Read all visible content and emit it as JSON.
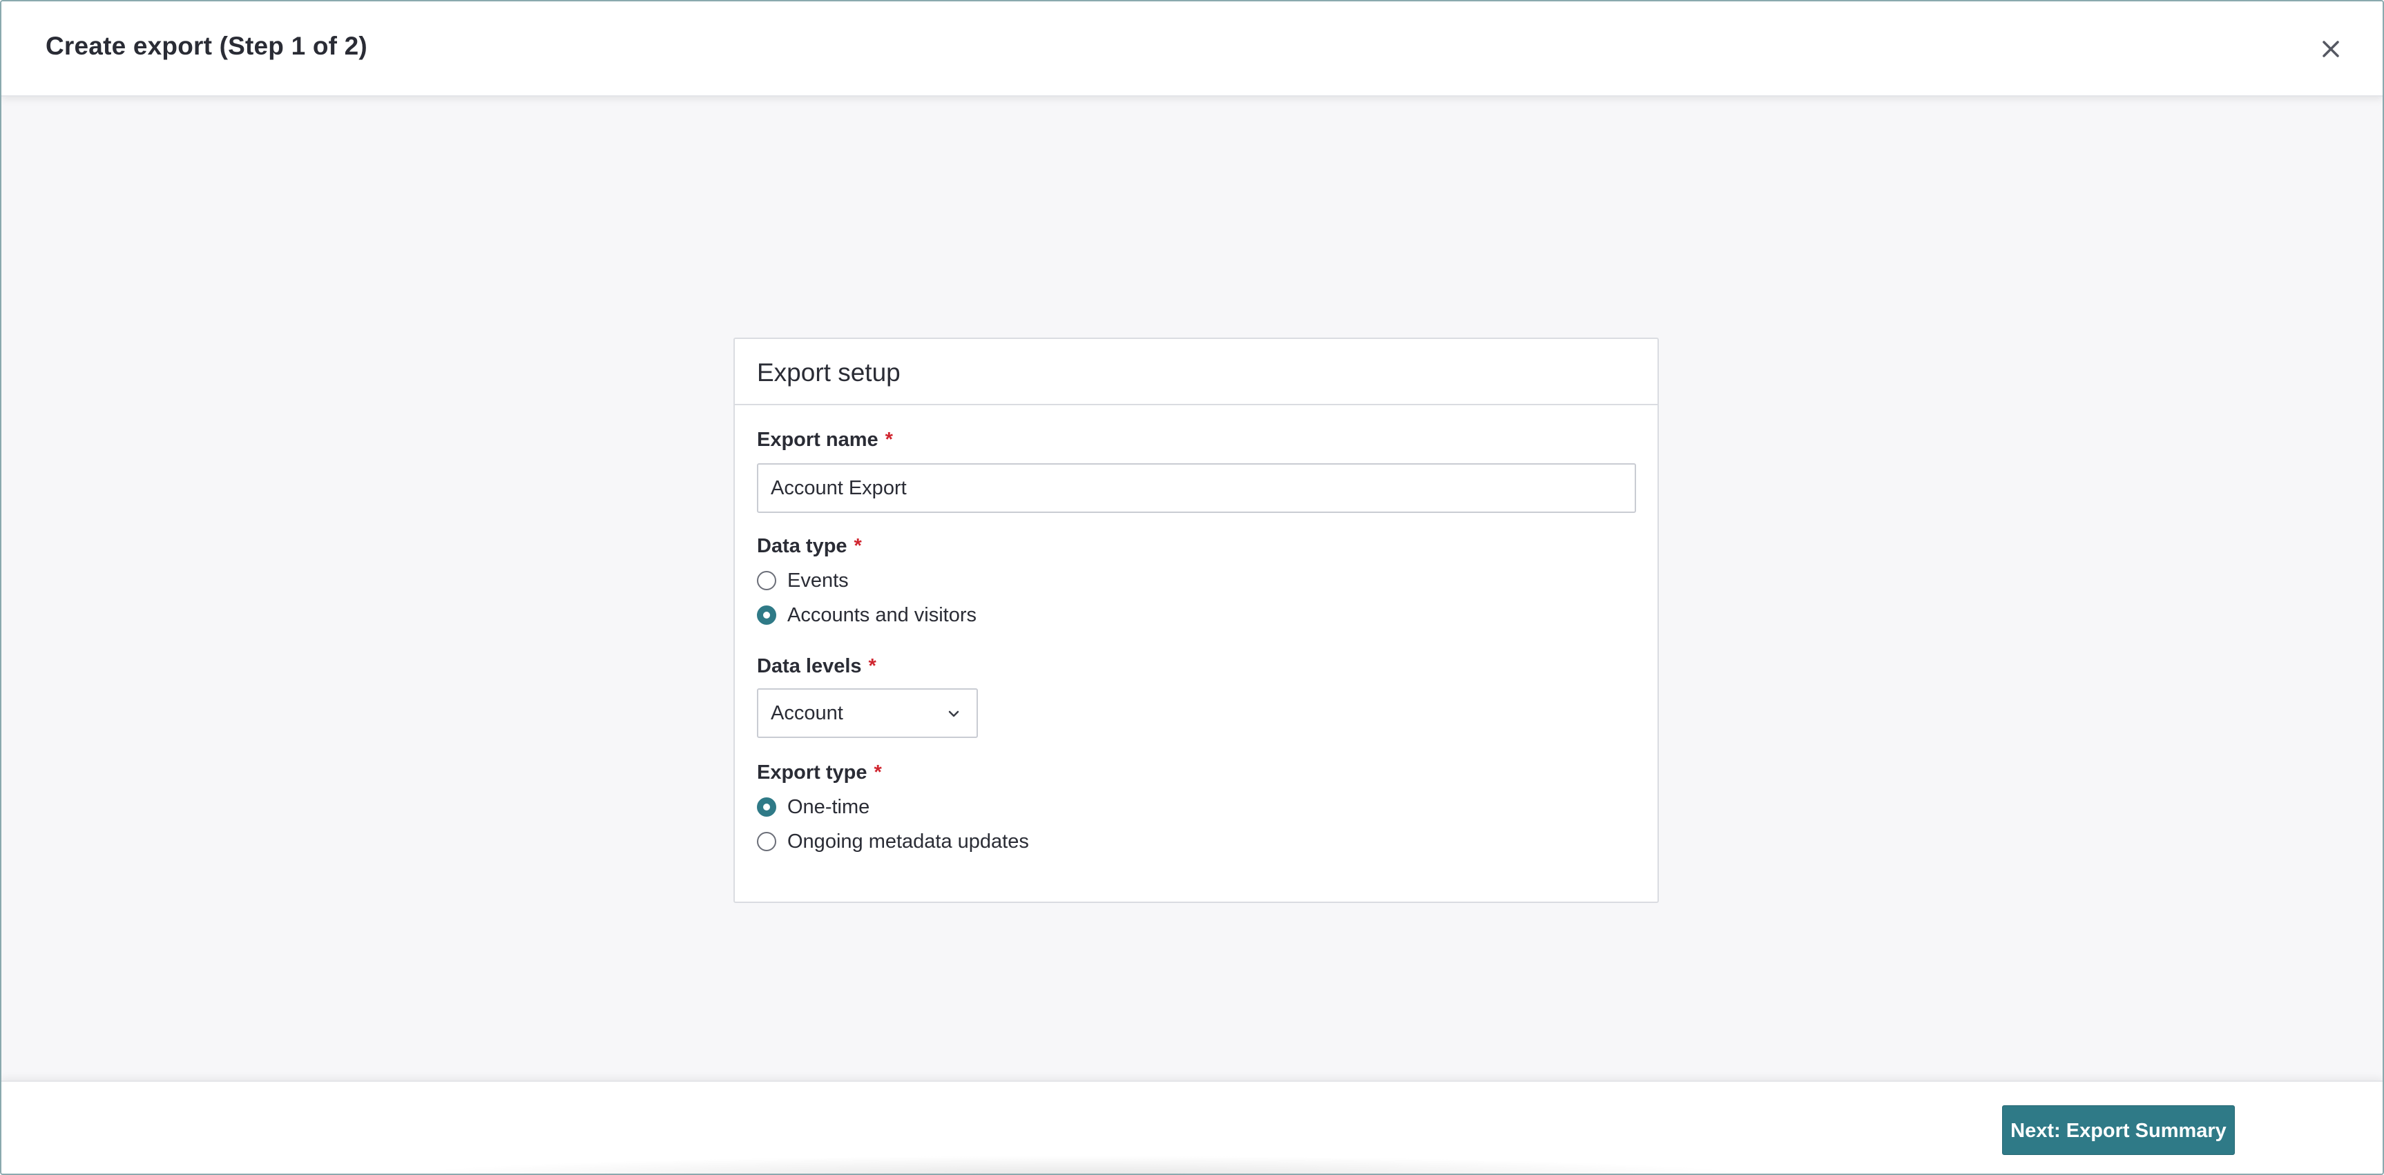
{
  "dialog": {
    "title": "Create export (Step 1 of 2)",
    "close_icon": "close-icon"
  },
  "card": {
    "title": "Export setup"
  },
  "form": {
    "export_name": {
      "label": "Export name",
      "required_marker": "*",
      "value": "Account Export"
    },
    "data_type": {
      "label": "Data type",
      "required_marker": "*",
      "options": [
        {
          "label": "Events",
          "selected": false
        },
        {
          "label": "Accounts and visitors",
          "selected": true
        }
      ]
    },
    "data_levels": {
      "label": "Data levels",
      "required_marker": "*",
      "selected": "Account"
    },
    "export_type": {
      "label": "Export type",
      "required_marker": "*",
      "options": [
        {
          "label": "One-time",
          "selected": true
        },
        {
          "label": "Ongoing metadata updates",
          "selected": false
        }
      ]
    }
  },
  "footer": {
    "next_label": "Next: Export Summary"
  },
  "colors": {
    "accent": "#2f7a87",
    "required": "#d0252f",
    "background": "#f7f7f9"
  }
}
